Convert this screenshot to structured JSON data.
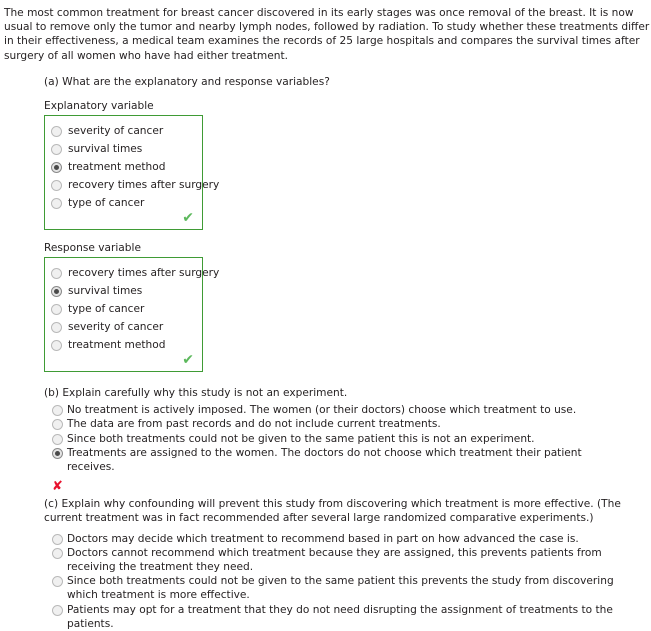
{
  "intro": {
    "paragraph": "The most common treatment for breast cancer discovered in its early stages was once removal of the breast. It is now usual to remove only the tumor and nearby lymph nodes, followed by radiation. To study whether these treatments differ in their effectiveness, a medical team examines the records of 25 large hospitals and compares the survival times after surgery of all women who have had either treatment."
  },
  "colors": {
    "correct_green": "#3f9b35",
    "check_green": "#5cb85c",
    "incorrect_red": "#e8112d",
    "text": "#231f20"
  },
  "parts": {
    "a": {
      "prompt": "(a) What are the explanatory and response variables?",
      "groups": [
        {
          "title": "Explanatory variable",
          "status_icon": "green-check-icon",
          "status": "correct",
          "options": [
            {
              "label": "severity of cancer",
              "selected": false
            },
            {
              "label": "survival times",
              "selected": false
            },
            {
              "label": "treatment method",
              "selected": true
            },
            {
              "label": "recovery times after surgery",
              "selected": false
            },
            {
              "label": "type of cancer",
              "selected": false
            }
          ]
        },
        {
          "title": "Response variable",
          "status_icon": "green-check-icon",
          "status": "correct",
          "options": [
            {
              "label": "recovery times after surgery",
              "selected": false
            },
            {
              "label": "survival times",
              "selected": true
            },
            {
              "label": "type of cancer",
              "selected": false
            },
            {
              "label": "severity of cancer",
              "selected": false
            },
            {
              "label": "treatment method",
              "selected": false
            }
          ]
        }
      ]
    },
    "b": {
      "prompt": "(b) Explain carefully why this study is not an experiment.",
      "status_icon": "red-cross-icon",
      "status": "incorrect",
      "status_glyph": "✘",
      "options": [
        {
          "label": "No treatment is actively imposed. The women (or their doctors) choose which treatment to use.",
          "selected": false
        },
        {
          "label": "The data are from past records and do not include current treatments.",
          "selected": false
        },
        {
          "label": "Since both treatments could not be given to the same patient this is not an experiment.",
          "selected": false
        },
        {
          "label": "Treatments are assigned to the women. The doctors do not choose which treatment their patient receives.",
          "selected": true
        }
      ]
    },
    "c": {
      "prompt": "(c) Explain why confounding will prevent this study from discovering which treatment is more effective. (The current treatment was in fact recommended after several large randomized comparative experiments.)",
      "options": [
        {
          "label": "Doctors may decide which treatment to recommend based in part on how advanced the case is.",
          "selected": false
        },
        {
          "label": "Doctors cannot recommend which treatment because they are assigned, this prevents patients from receiving the treatment they need.",
          "selected": false
        },
        {
          "label": "Since both treatments could not be given to the same patient this prevents the study from discovering which treatment is more effective.",
          "selected": false
        },
        {
          "label": "Patients may opt for a treatment that they do not need disrupting the assignment of treatments to the patients.",
          "selected": false
        }
      ]
    }
  },
  "glyphs": {
    "check": "✔"
  }
}
